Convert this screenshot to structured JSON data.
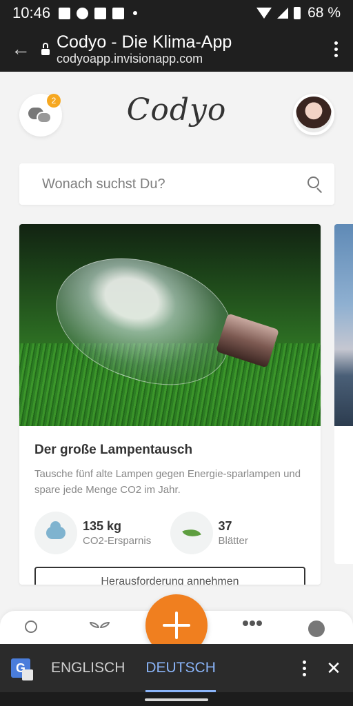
{
  "status_bar": {
    "time": "10:46",
    "battery_percent": "68 %",
    "icons_left": [
      "image-icon",
      "facebook-icon",
      "home-icon",
      "app-icon"
    ],
    "icons_right": [
      "wifi-icon",
      "signal-icon",
      "battery-icon"
    ]
  },
  "browser": {
    "title": "Codyo - Die Klima-App",
    "url": "codyoapp.invisionapp.com"
  },
  "app": {
    "logo": "Codyo",
    "chat_badge": "2",
    "search": {
      "placeholder": "Wonach suchst Du?"
    },
    "card": {
      "title": "Der große Lampentausch",
      "description": "Tausche fünf alte Lampen gegen Energie-sparlampen und spare jede Menge CO2 im Jahr.",
      "stats": [
        {
          "value": "135 kg",
          "label": "CO2-Ersparnis",
          "icon": "cloud-icon"
        },
        {
          "value": "37",
          "label": "Blätter",
          "icon": "leaf-icon"
        }
      ],
      "cta": "Herausforderung annehmen"
    },
    "nav": {
      "items": [
        "search-icon",
        "sprout-icon",
        "add-button",
        "people-icon",
        "planet-icon"
      ]
    }
  },
  "translate_bar": {
    "source": "ENGLISCH",
    "target": "DEUTSCH"
  },
  "colors": {
    "accent_orange": "#f07f1f",
    "badge": "#f6a821",
    "translate_active": "#8ab4f8"
  }
}
